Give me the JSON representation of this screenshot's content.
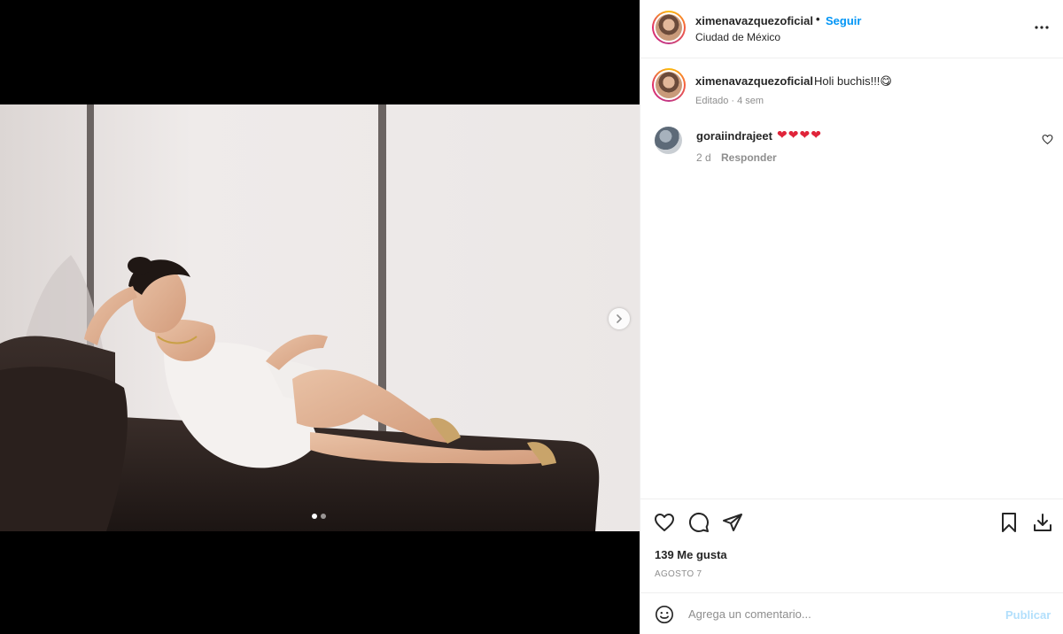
{
  "post": {
    "username": "ximenavazquezoficial",
    "follow_label": "Seguir",
    "separator": "•",
    "location": "Ciudad de México",
    "caption": "Holi buchis!!!😋",
    "caption_meta": "Editado · 4 sem",
    "likes": "139 Me gusta",
    "date": "AGOSTO 7"
  },
  "carousel": {
    "current": 1,
    "total": 2
  },
  "comments": [
    {
      "username": "goraiindrajeet",
      "text": "❤❤❤❤",
      "time": "2 d",
      "reply_label": "Responder"
    }
  ],
  "composer": {
    "placeholder": "Agrega un comentario...",
    "post_label": "Publicar"
  },
  "icons": {
    "more": "more-options-icon",
    "like": "heart-icon",
    "comment": "comment-icon",
    "share": "send-icon",
    "save": "bookmark-icon",
    "download": "download-icon",
    "emoji": "emoji-icon",
    "next": "chevron-right-icon"
  },
  "colors": {
    "accent": "#0095f6",
    "post_disabled": "#b2dffc",
    "secondary_text": "#8e8e8e",
    "heart": "#e0243a"
  }
}
